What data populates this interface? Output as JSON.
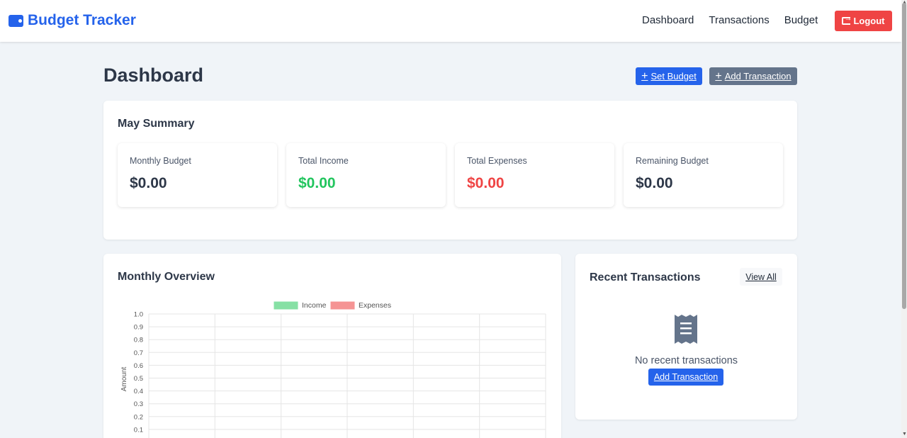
{
  "app": {
    "name": "Budget Tracker",
    "brand_color": "#2563eb"
  },
  "nav": {
    "links": [
      "Dashboard",
      "Transactions",
      "Budget"
    ],
    "logout_label": "Logout"
  },
  "header": {
    "title": "Dashboard",
    "set_budget_label": "Set Budget",
    "add_transaction_label": "Add Transaction"
  },
  "summary": {
    "title": "May Summary",
    "stats": [
      {
        "label": "Monthly Budget",
        "value": "$0.00",
        "color": "#2d3748"
      },
      {
        "label": "Total Income",
        "value": "$0.00",
        "color": "#22c55e"
      },
      {
        "label": "Total Expenses",
        "value": "$0.00",
        "color": "#ef4444"
      },
      {
        "label": "Remaining Budget",
        "value": "$0.00",
        "color": "#2d3748"
      }
    ]
  },
  "overview": {
    "title": "Monthly Overview"
  },
  "recent": {
    "title": "Recent Transactions",
    "view_all_label": "View All",
    "empty_text": "No recent transactions",
    "add_label": "Add Transaction",
    "icon": "receipt-icon"
  },
  "chart_data": {
    "type": "bar",
    "title": "",
    "xlabel": "",
    "ylabel": "Amount",
    "ylim": [
      0,
      1.0
    ],
    "yticks": [
      "1.0",
      "0.9",
      "0.8",
      "0.7",
      "0.6",
      "0.5",
      "0.4",
      "0.3",
      "0.2",
      "0.1"
    ],
    "legend_position": "top",
    "categories": [],
    "series": [
      {
        "name": "Income",
        "color": "#86e0a4",
        "values": []
      },
      {
        "name": "Expenses",
        "color": "#f59494",
        "values": []
      }
    ],
    "grid": true
  }
}
